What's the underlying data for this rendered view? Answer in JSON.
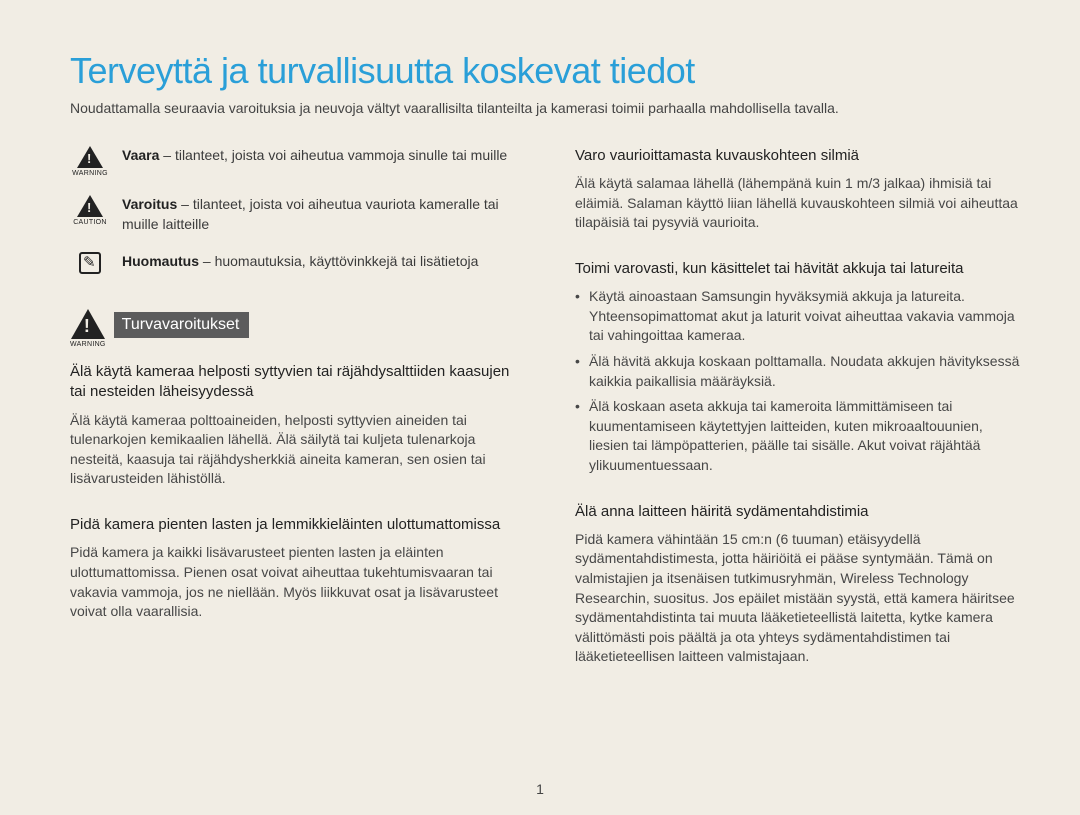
{
  "title": "Terveyttä ja turvallisuutta koskevat tiedot",
  "intro": "Noudattamalla seuraavia varoituksia ja neuvoja vältyt vaarallisilta tilanteilta ja kamerasi toimii parhaalla mahdollisella tavalla.",
  "legend": {
    "warning": {
      "term": "Vaara",
      "rest": " – tilanteet, joista voi aiheutua vammoja sinulle tai muille",
      "label": "WARNING"
    },
    "caution": {
      "term": "Varoitus",
      "rest": " – tilanteet, joista voi aiheutua vauriota kameralle tai muille laitteille",
      "label": "CAUTION"
    },
    "note": {
      "term": "Huomautus",
      "rest": " – huomautuksia, käyttövinkkejä tai lisätietoja"
    }
  },
  "banner": {
    "text": "Turvavaroitukset",
    "label": "WARNING"
  },
  "left": {
    "s1h": "Älä käytä kameraa helposti syttyvien tai räjähdysalttiiden kaasujen tai nesteiden läheisyydessä",
    "s1p": "Älä käytä kameraa polttoaineiden, helposti syttyvien aineiden tai tulenarkojen kemikaalien lähellä. Älä säilytä tai kuljeta tulenarkoja nesteitä, kaasuja tai räjähdysherkkiä aineita kameran, sen osien tai lisävarusteiden lähistöllä.",
    "s2h": "Pidä kamera pienten lasten ja lemmikkieläinten ulottumattomissa",
    "s2p": "Pidä kamera ja kaikki lisävarusteet pienten lasten ja eläinten ulottumattomissa. Pienen osat voivat aiheuttaa tukehtumisvaaran tai vakavia vammoja, jos ne niellään. Myös liikkuvat osat ja lisävarusteet voivat olla vaarallisia."
  },
  "right": {
    "s1h": "Varo vaurioittamasta kuvauskohteen silmiä",
    "s1p": "Älä käytä salamaa lähellä (lähempänä kuin 1 m/3 jalkaa) ihmisiä tai eläimiä. Salaman käyttö liian lähellä kuvauskohteen silmiä voi aiheuttaa tilapäisiä tai pysyviä vaurioita.",
    "s2h": "Toimi varovasti, kun käsittelet tai hävität akkuja tai latureita",
    "b1": "Käytä ainoastaan Samsungin hyväksymiä akkuja ja latureita. Yhteensopimattomat akut ja laturit voivat aiheuttaa vakavia vammoja tai vahingoittaa kameraa.",
    "b2": "Älä hävitä akkuja koskaan polttamalla. Noudata akkujen hävityksessä kaikkia paikallisia määräyksiä.",
    "b3": "Älä koskaan aseta akkuja tai kameroita lämmittämiseen tai kuumentamiseen käytettyjen laitteiden, kuten mikroaaltouunien, liesien tai lämpöpatterien, päälle tai sisälle. Akut voivat räjähtää ylikuumentuessaan.",
    "s3h": "Älä anna laitteen häiritä sydämentahdistimia",
    "s3p": "Pidä kamera vähintään 15 cm:n (6 tuuman) etäisyydellä sydämentahdistimesta, jotta häiriöitä ei pääse syntymään. Tämä on valmistajien ja itsenäisen tutkimusryhmän, Wireless Technology Researchin, suositus. Jos epäilet mistään syystä, että kamera häiritsee sydämentahdistinta tai muuta lääketieteellistä laitetta, kytke kamera välittömästi pois päältä ja ota yhteys sydämentahdistimen tai lääketieteellisen laitteen valmistajaan."
  },
  "page": "1"
}
